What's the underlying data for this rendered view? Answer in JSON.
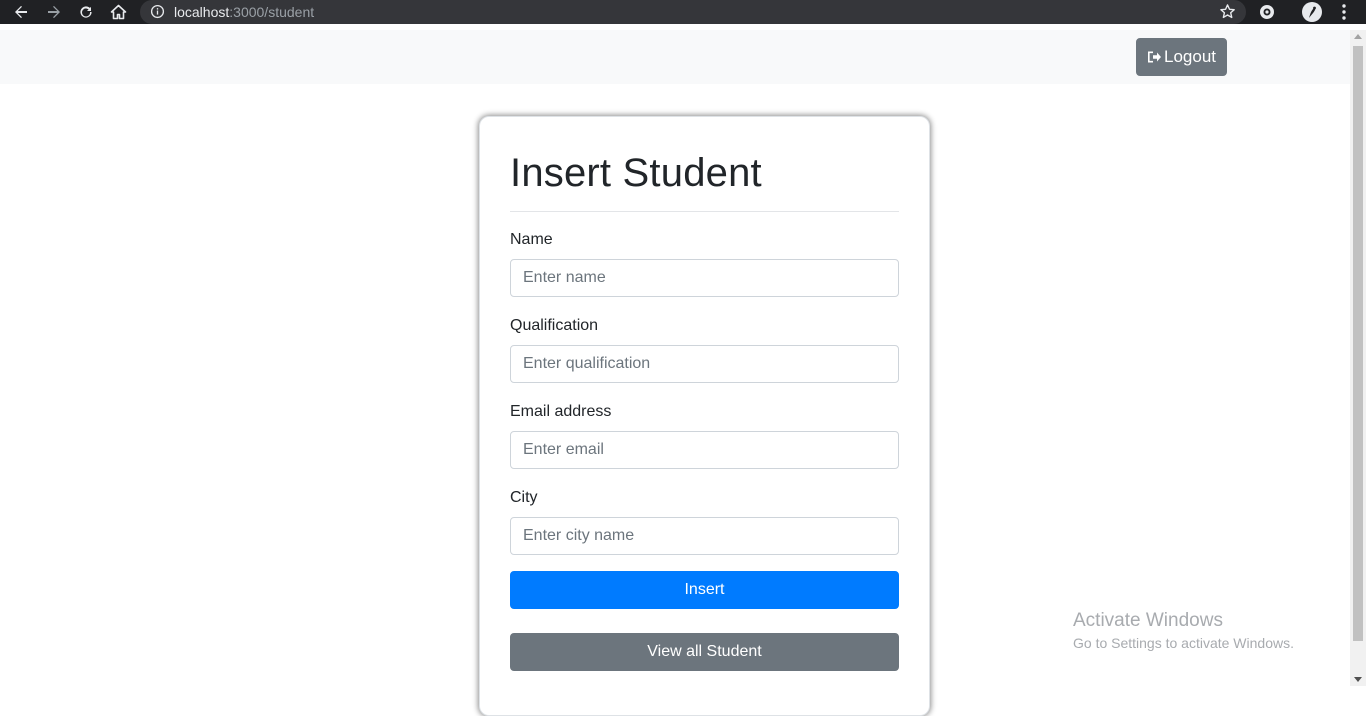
{
  "browser": {
    "url_host": "localhost",
    "url_rest": ":3000/student",
    "icons": [
      "back-arrow-icon",
      "forward-arrow-icon",
      "reload-icon",
      "home-icon",
      "info-icon",
      "star-icon",
      "extension-icon",
      "profile-icon",
      "menu-dots-icon"
    ]
  },
  "header": {
    "logout_label": "Logout",
    "logout_icon": "sign-out-icon"
  },
  "form": {
    "title": "Insert Student",
    "fields": [
      {
        "label": "Name",
        "placeholder": "Enter name"
      },
      {
        "label": "Qualification",
        "placeholder": "Enter qualification"
      },
      {
        "label": "Email address",
        "placeholder": "Enter email"
      },
      {
        "label": "City",
        "placeholder": "Enter city name"
      }
    ],
    "insert_label": "Insert",
    "view_all_label": "View all Student"
  },
  "watermark": {
    "line1": "Activate Windows",
    "line2": "Go to Settings to activate Windows."
  },
  "colors": {
    "primary": "#007bff",
    "secondary": "#6c757d",
    "topbar": "#f8f9fa",
    "chrome": "#202124"
  }
}
